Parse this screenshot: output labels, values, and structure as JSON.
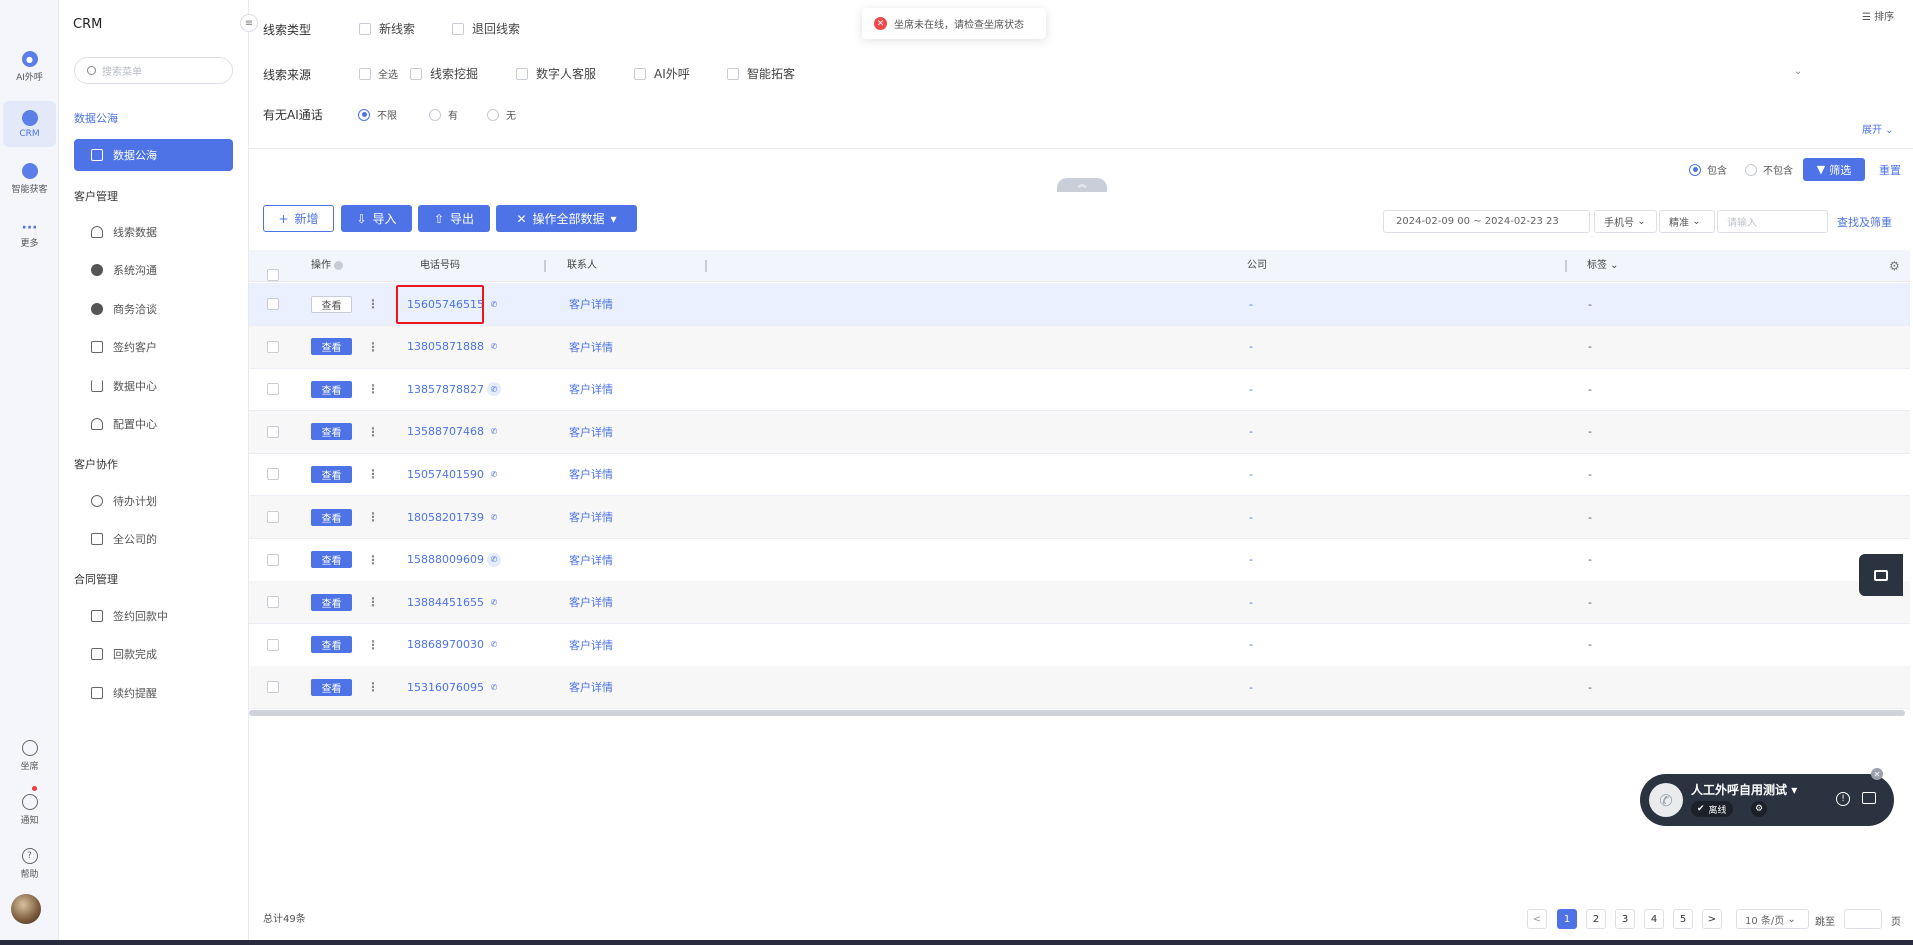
{
  "rail": {
    "items": [
      {
        "label": "AI外呼"
      },
      {
        "label": "CRM"
      },
      {
        "label": "智能获客"
      },
      {
        "label": "更多"
      }
    ],
    "bottom": [
      {
        "label": "坐席"
      },
      {
        "label": "通知"
      },
      {
        "label": "帮助"
      }
    ]
  },
  "sidebar": {
    "title": "CRM",
    "search_placeholder": "搜索菜单",
    "groups": [
      {
        "label": "数据公海",
        "items": [
          {
            "label": "数据公海"
          }
        ]
      },
      {
        "label": "客户管理",
        "items": [
          {
            "label": "线索数据"
          },
          {
            "label": "系统沟通"
          },
          {
            "label": "商务洽谈"
          },
          {
            "label": "签约客户"
          },
          {
            "label": "数据中心"
          },
          {
            "label": "配置中心"
          }
        ]
      },
      {
        "label": "客户协作",
        "items": [
          {
            "label": "待办计划"
          },
          {
            "label": "全公司的"
          }
        ]
      },
      {
        "label": "合同管理",
        "items": [
          {
            "label": "签约回款中"
          },
          {
            "label": "回款完成"
          },
          {
            "label": "续约提醒"
          }
        ]
      }
    ]
  },
  "toast": {
    "text": "坐席未在线，请检查坐席状态"
  },
  "sort_label": "排序",
  "filters": {
    "clue_type": {
      "label": "线索类型",
      "options": [
        "新线索",
        "退回线索"
      ]
    },
    "clue_source": {
      "label": "线索来源",
      "options": [
        "全选",
        "线索挖掘",
        "数字人客服",
        "AI外呼",
        "智能拓客"
      ]
    },
    "ai_call": {
      "label": "有无AI通话",
      "options": [
        "不限",
        "有",
        "无"
      ],
      "selected": "不限"
    },
    "expand_label": "展开",
    "include_options": [
      "包含",
      "不包含"
    ],
    "include_selected": "包含",
    "filter_button": "筛选",
    "reset_label": "重置"
  },
  "toolbar": {
    "add_label": "新增",
    "import_label": "导入",
    "export_label": "导出",
    "operate_all_label": "操作全部数据",
    "date_range": "2024-02-09 00 ~ 2024-02-23 23",
    "field_select": "手机号",
    "match_select": "精准",
    "search_placeholder": "请输入",
    "find_label": "查找及筛重"
  },
  "table": {
    "headers": {
      "action": "操作",
      "phone": "电话号码",
      "contact": "联系人",
      "company": "公司",
      "tags": "标签"
    },
    "view_label": "查看",
    "rows": [
      {
        "phone": "15605746515",
        "contact": "客户详情",
        "company": "-",
        "tags": "-"
      },
      {
        "phone": "13805871888",
        "contact": "客户详情",
        "company": "-",
        "tags": "-"
      },
      {
        "phone": "13857878827",
        "contact": "客户详情",
        "company": "-",
        "tags": "-"
      },
      {
        "phone": "13588707468",
        "contact": "客户详情",
        "company": "-",
        "tags": "-"
      },
      {
        "phone": "15057401590",
        "contact": "客户详情",
        "company": "-",
        "tags": "-"
      },
      {
        "phone": "18058201739",
        "contact": "客户详情",
        "company": "-",
        "tags": "-"
      },
      {
        "phone": "15888009609",
        "contact": "客户详情",
        "company": "-",
        "tags": "-"
      },
      {
        "phone": "13884451655",
        "contact": "客户详情",
        "company": "-",
        "tags": "-"
      },
      {
        "phone": "18868970030",
        "contact": "客户详情",
        "company": "-",
        "tags": "-"
      },
      {
        "phone": "15316076095",
        "contact": "客户详情",
        "company": "-",
        "tags": "-"
      }
    ]
  },
  "call_widget": {
    "name": "人工外呼自用测试",
    "status": "离线"
  },
  "footer": {
    "total": "总计49条",
    "pages": [
      "1",
      "2",
      "3",
      "4",
      "5"
    ],
    "current_page": "1",
    "page_size": "10 条/页",
    "jump_label": "跳至",
    "page_unit": "页"
  },
  "colors": {
    "accent": "#4d73e6",
    "error": "#f04848",
    "highlight_box": "#e8181b"
  }
}
